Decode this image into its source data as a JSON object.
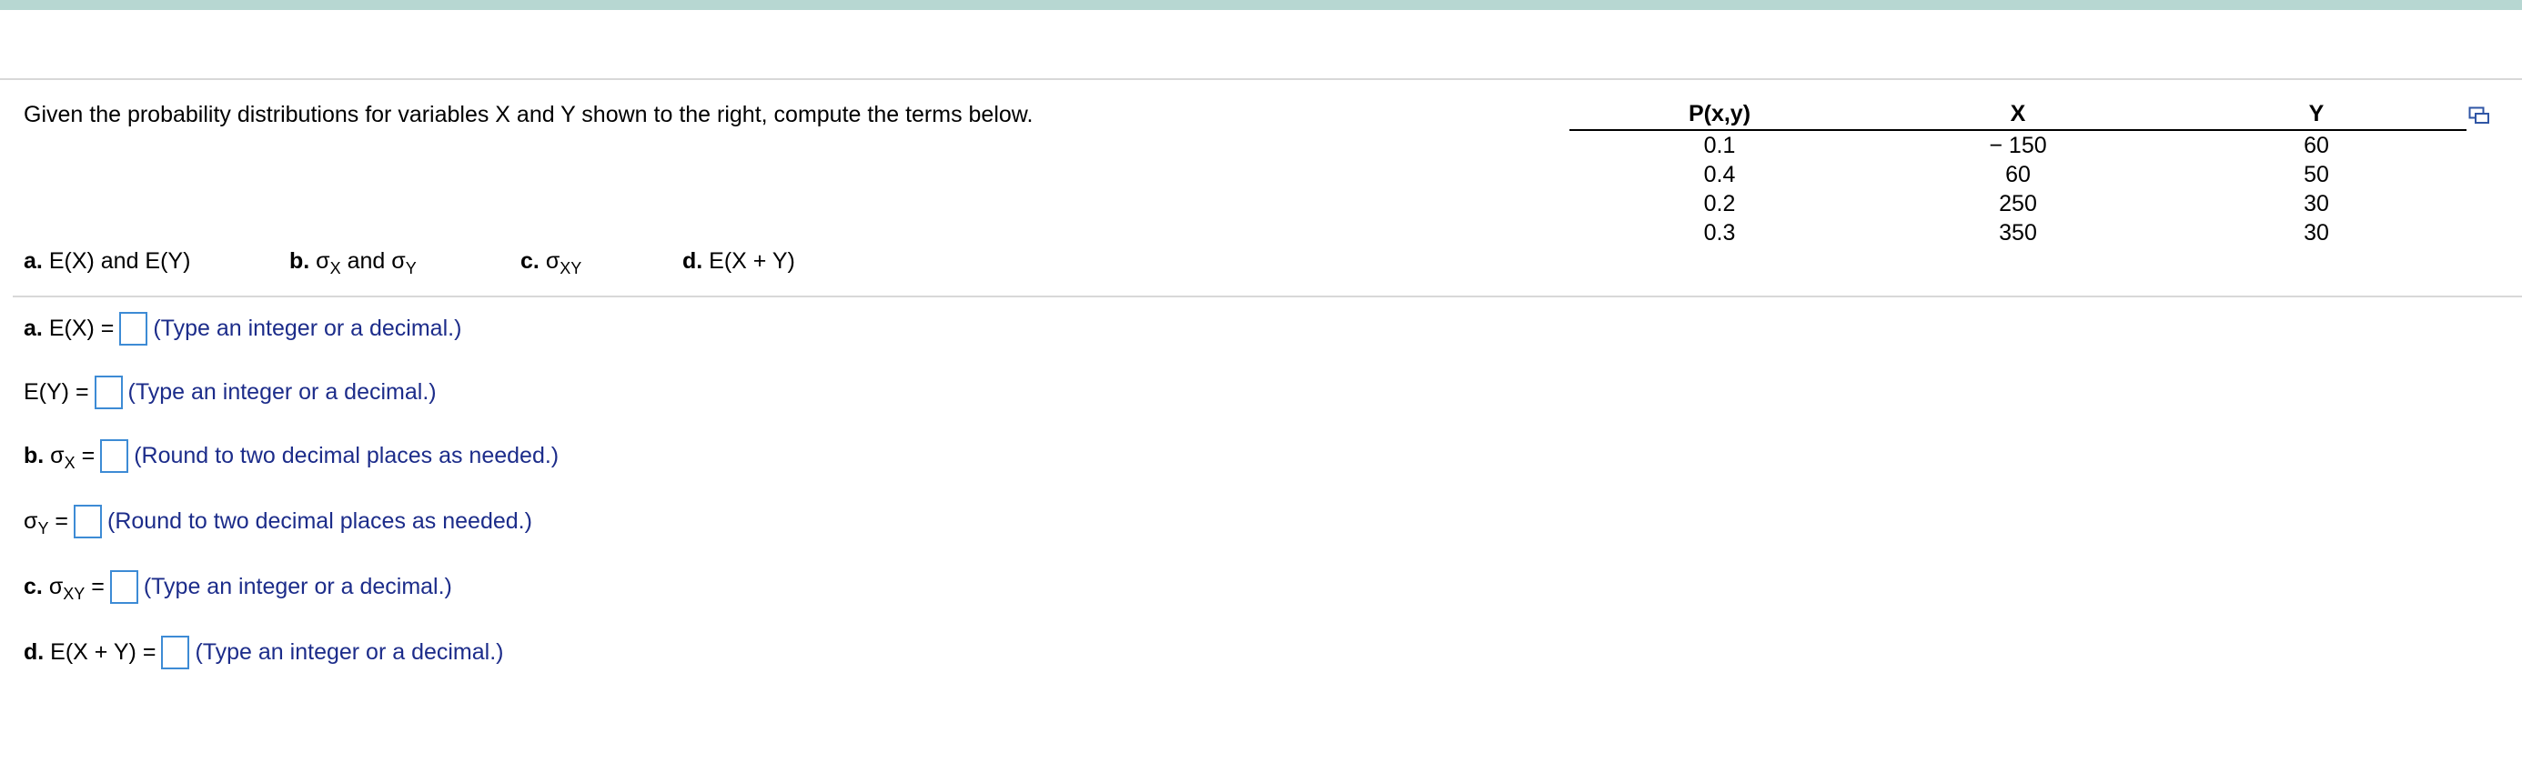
{
  "question": {
    "text": "Given the probability distributions for variables X and Y shown to the right, compute the terms below."
  },
  "table": {
    "headers": [
      "P(x,y)",
      "X",
      "Y"
    ],
    "rows": [
      [
        "0.1",
        "− 150",
        "60"
      ],
      [
        "0.4",
        "60",
        "50"
      ],
      [
        "0.2",
        "250",
        "30"
      ],
      [
        "0.3",
        "350",
        "30"
      ]
    ]
  },
  "parts": {
    "a": {
      "prefix": "a.",
      "text": "E(X) and E(Y)"
    },
    "b": {
      "prefix": "b.",
      "sigma": "σ",
      "sub1": "X",
      "mid": "and",
      "sub2": "Y"
    },
    "c": {
      "prefix": "c.",
      "sigma": "σ",
      "sub": "XY"
    },
    "d": {
      "prefix": "d.",
      "text": "E(X + Y)"
    }
  },
  "answers": {
    "ex": {
      "prefix": "a.",
      "label": "E(X) =",
      "hint": "(Type an integer or a decimal.)"
    },
    "ey": {
      "label": "E(Y) =",
      "hint": "(Type an integer or a decimal.)"
    },
    "sx": {
      "prefix": "b.",
      "sigma": "σ",
      "sub": "X",
      "eq": "=",
      "hint": "(Round to two decimal places as needed.)"
    },
    "sy": {
      "sigma": "σ",
      "sub": "Y",
      "eq": "=",
      "hint": "(Round to two decimal places as needed.)"
    },
    "sxy": {
      "prefix": "c.",
      "sigma": "σ",
      "sub": "XY",
      "eq": "=",
      "hint": "(Type an integer or a decimal.)"
    },
    "exy": {
      "prefix": "d.",
      "label": "E(X + Y) =",
      "hint": "(Type an integer or a decimal.)"
    }
  },
  "icons": {
    "copy": "copy-table-icon"
  },
  "colors": {
    "accent_bar": "#b7d7d2",
    "input_border": "#3d8bd5",
    "hint_text": "#1c2c8a"
  }
}
